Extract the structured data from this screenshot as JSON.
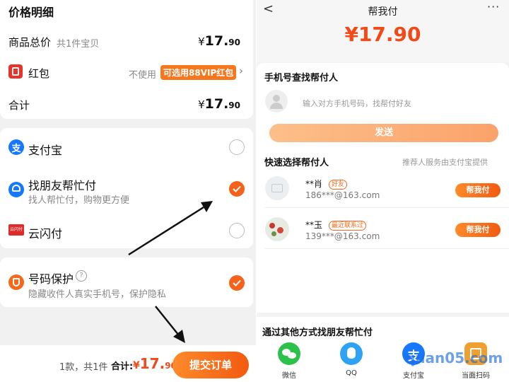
{
  "left": {
    "section_title": "价格明细",
    "goods_total_label": "商品总价",
    "goods_count": "共1件宝贝",
    "currency": "¥",
    "goods_total_int": "17.",
    "goods_total_dec": "90",
    "redpacket_label": "红包",
    "redpacket_status": "不使用",
    "redpacket_tag": "可选用88VIP红包",
    "sum_label": "合计",
    "sum_int": "17.",
    "sum_dec": "90",
    "payments": [
      {
        "name": "支付宝",
        "desc": "",
        "selected": false
      },
      {
        "name": "找朋友帮忙付",
        "desc": "找人帮忙付，购物更方便",
        "selected": true
      },
      {
        "name": "云闪付",
        "desc": "",
        "selected": false
      }
    ],
    "unionpay_icon_text": "云闪付",
    "privacy_label": "号码保护",
    "privacy_help": "?",
    "privacy_desc": "隐藏收件人真实手机号，保护隐私",
    "privacy_selected": true,
    "footer_count": "1款，共1件",
    "footer_total_label": "合计:",
    "footer_currency": "¥",
    "footer_int": "17.",
    "footer_dec": "90",
    "submit_label": "提交订单"
  },
  "right": {
    "nav_title": "帮我付",
    "amount": "¥17.90",
    "phone_section_title": "手机号查找帮付人",
    "phone_placeholder": "输入对方手机号码，找帮付好友",
    "send_label": "发送",
    "quick_title": "快速选择帮付人",
    "quick_note": "推荐人服务由支付宝提供",
    "contacts": [
      {
        "name": "**肖",
        "tag": "好友",
        "email": "186***@163.com",
        "btn": "帮我付"
      },
      {
        "name": "**玉",
        "tag": "最近联系过",
        "email": "139***@163.com",
        "btn": "帮我付"
      }
    ],
    "other_title": "通过其他方式找朋友帮忙付",
    "share": [
      {
        "label": "微信",
        "color": "#2bc14b"
      },
      {
        "label": "QQ",
        "color": "#2ea2f4"
      },
      {
        "label": "支付宝",
        "color": "#1677ff"
      },
      {
        "label": "当面扫码",
        "color": "#f0a030"
      }
    ],
    "watermark": "quan05.com"
  },
  "colors": {
    "accent": "#f5621b",
    "price_red": "#f04a1a"
  }
}
